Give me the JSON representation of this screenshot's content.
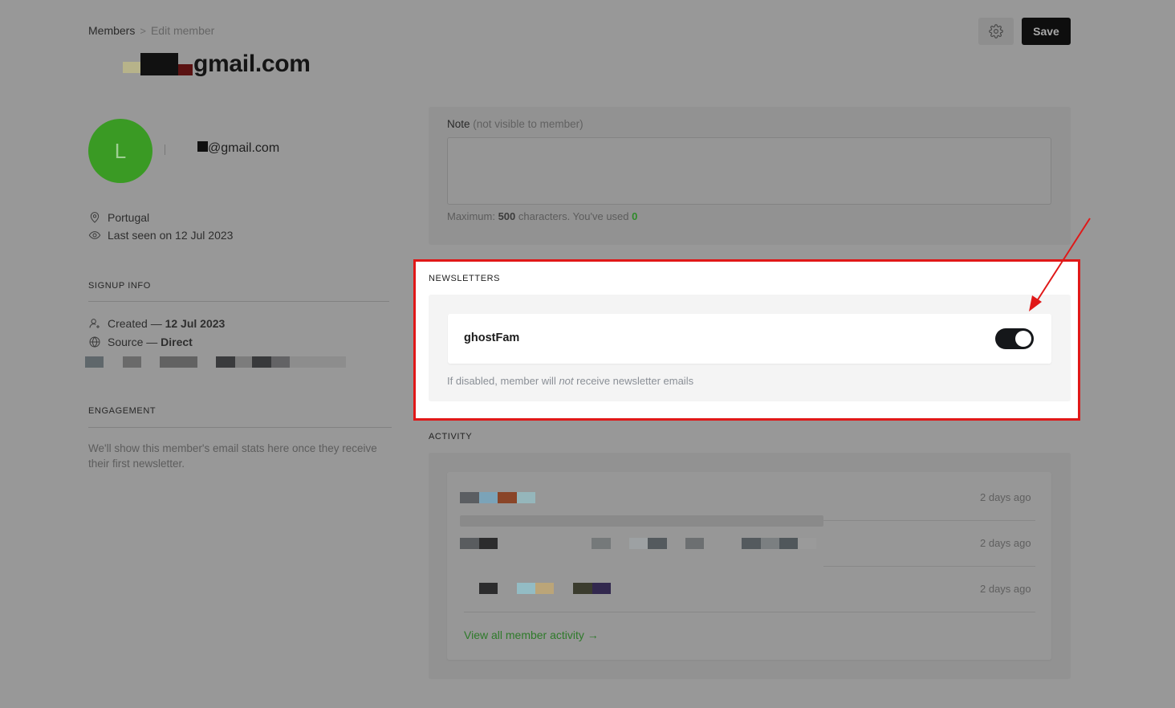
{
  "breadcrumb": {
    "parent": "Members",
    "separator": ">",
    "current": "Edit member"
  },
  "header": {
    "title_visible_suffix": "gmail.com",
    "settings_icon": "gear-icon",
    "save_label": "Save"
  },
  "member": {
    "avatar_initial": "L",
    "avatar_color": "#3a9a24",
    "email_visible_suffix": "@gmail.com",
    "location": "Portugal",
    "last_seen": "Last seen on 12 Jul 2023"
  },
  "signup_info": {
    "heading": "SIGNUP INFO",
    "created_label": "Created — ",
    "created_value": "12 Jul 2023",
    "source_label": "Source — ",
    "source_value": "Direct"
  },
  "engagement": {
    "heading": "ENGAGEMENT",
    "text": "We'll show this member's email stats here once they receive their first newsletter."
  },
  "note": {
    "label": "Note",
    "label_hint": "(not visible to member)",
    "value": "",
    "help_prefix": "Maximum: ",
    "max_chars": "500",
    "help_middle": " characters. You've used ",
    "used_chars": "0"
  },
  "newsletters": {
    "heading": "NEWSLETTERS",
    "items": [
      {
        "name": "ghostFam",
        "subscribed": true
      }
    ],
    "hint_before": "If disabled, member will ",
    "hint_em": "not",
    "hint_after": " receive newsletter emails"
  },
  "activity": {
    "heading": "ACTIVITY",
    "items": [
      {
        "time": "2 days ago"
      },
      {
        "time": "2 days ago"
      },
      {
        "time": "2 days ago"
      }
    ],
    "view_all_label": "View all member activity →"
  },
  "annotation": {
    "highlight_color": "#e01818"
  }
}
